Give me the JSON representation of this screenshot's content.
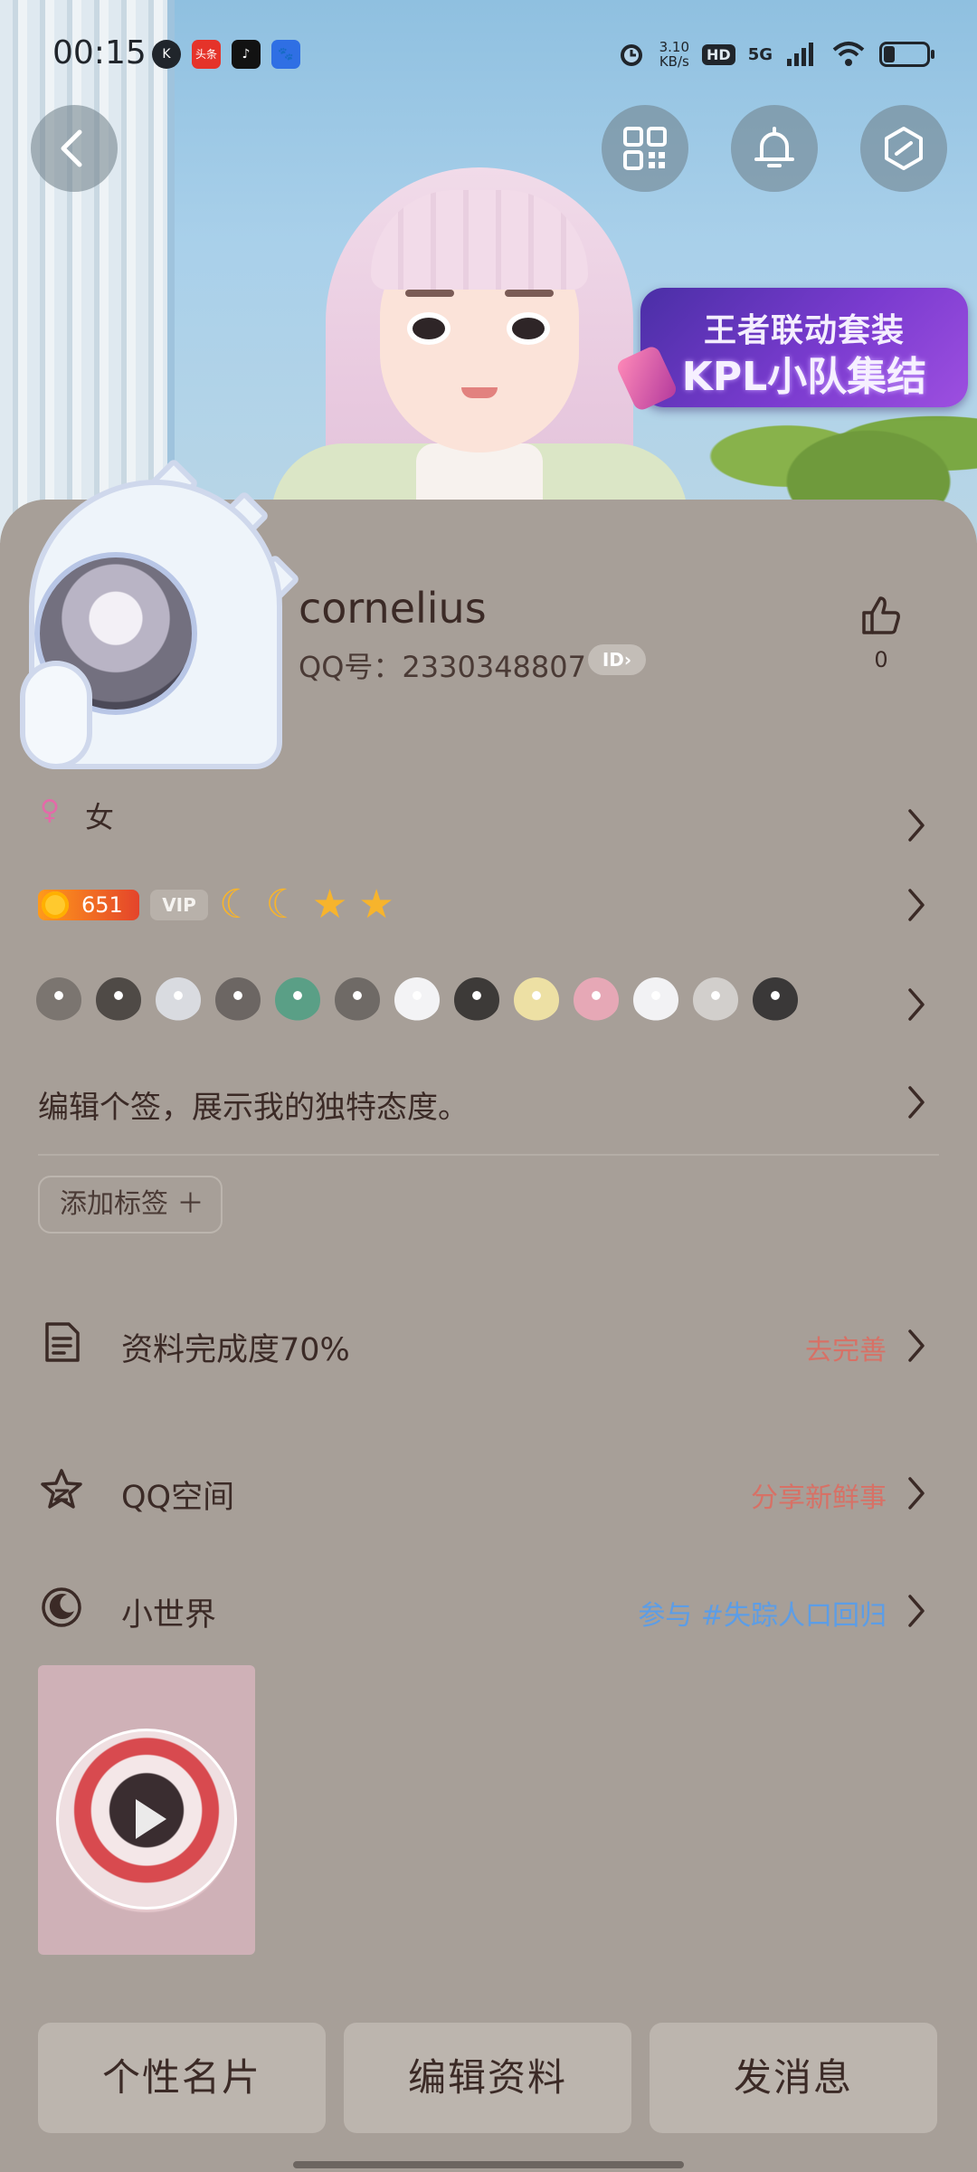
{
  "status_bar": {
    "time": "00:15",
    "apps": [
      "K",
      "头条",
      "♪",
      "🐾"
    ],
    "net_speed": "3.10",
    "net_unit": "KB/s",
    "hd": "HD",
    "signal": "5G"
  },
  "header": {
    "buttons": [
      "back-icon",
      "qr-code-icon",
      "bell-icon",
      "hexagon-icon"
    ]
  },
  "promo": {
    "line1": "王者联动套装",
    "line2": "KPL小队集结"
  },
  "profile": {
    "username": "cornelius",
    "qq_label": "QQ号：",
    "qq_number": "2330348807",
    "id_badge": "ID›",
    "like_count": "0",
    "gender_symbol": "♀",
    "gender": "女",
    "coin_value": "651",
    "vip_label": "VIP",
    "level_icons": [
      "☾",
      "☾",
      "★",
      "★"
    ],
    "signature": "编辑个签，展示我的独特态度。",
    "add_tag": "添加标签 ＋"
  },
  "items": [
    {
      "label": "资料完成度70%",
      "action": "去完善"
    },
    {
      "label": "QQ空间",
      "action": "分享新鲜事"
    },
    {
      "label": "小世界",
      "action": "参与 #失踪人口回归"
    }
  ],
  "badge_colors": [
    "#7b7570",
    "#4f4a46",
    "#d9dbe0",
    "#6c6663",
    "#5a9f86",
    "#6f6a66",
    "#f3f3f5",
    "#3d3a38",
    "#ede0a4",
    "#e6a8b6",
    "#f2f2f4",
    "#d2cfcc",
    "#3a3838"
  ],
  "bottom_buttons": {
    "card": "个性名片",
    "edit": "编辑资料",
    "message": "发消息"
  },
  "colors": {
    "accent_action": "#d77166",
    "accent_link": "#5c9de6",
    "background": "#a79f98"
  }
}
